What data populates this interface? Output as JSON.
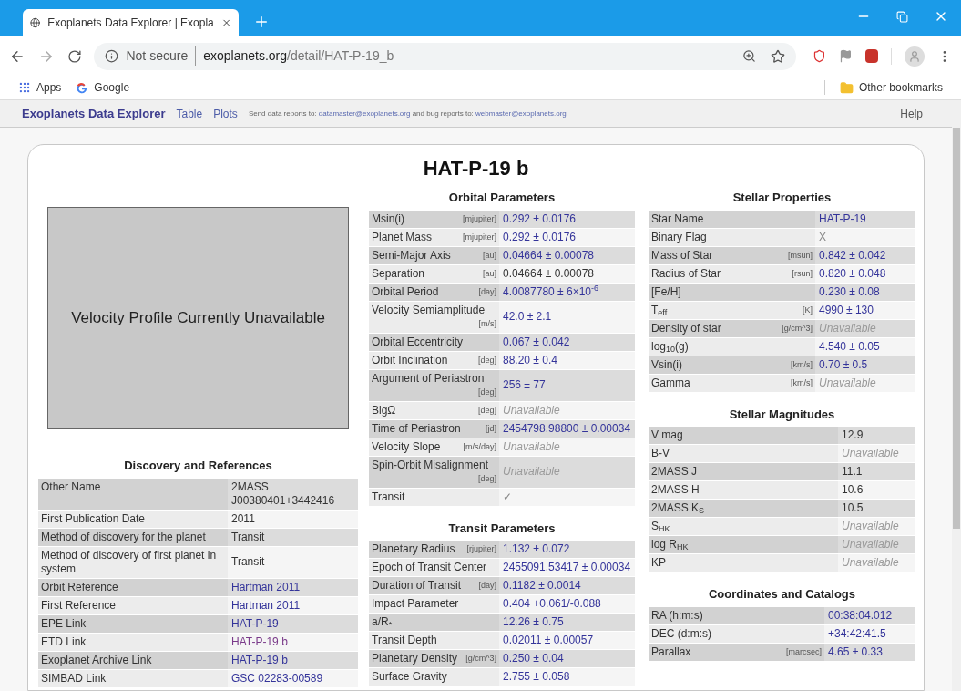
{
  "browser": {
    "tab": {
      "title": "Exoplanets Data Explorer | Exopla",
      "selected": true
    },
    "address": {
      "security": "Not secure",
      "host": "exoplanets.org",
      "path": "/detail/HAT-P-19_b"
    },
    "bookmarks": [
      {
        "kind": "apps",
        "label": "Apps"
      },
      {
        "kind": "google",
        "label": "Google"
      }
    ],
    "other_bookmarks": "Other bookmarks"
  },
  "site_nav": {
    "brand": "Exoplanets Data Explorer",
    "links": [
      "Table",
      "Plots"
    ],
    "notice": [
      {
        "kind": "text",
        "text": "Send data reports to: "
      },
      {
        "kind": "link",
        "text": "datamaster@exoplanets.org"
      },
      {
        "kind": "text",
        "text": " and bug reports to: "
      },
      {
        "kind": "link",
        "text": "webmaster@exoplanets.org"
      }
    ],
    "help": "Help"
  },
  "title": "HAT-P-19 b",
  "velocity_placeholder": "Velocity Profile Currently Unavailable",
  "columns": [
    [
      {
        "title": "Discovery and References",
        "rows": [
          {
            "label": "Other Name",
            "value": "2MASS J00380401+3442416",
            "kind": "plain"
          },
          {
            "label": "First Publication Date",
            "value": "2011",
            "kind": "plain"
          },
          {
            "label": "Method of discovery for the planet",
            "value": "Transit",
            "kind": "plain"
          },
          {
            "label": "Method of discovery of first planet in system",
            "value": "Transit",
            "kind": "plain"
          },
          {
            "label": "Orbit Reference",
            "value": "Hartman 2011",
            "kind": "link"
          },
          {
            "label": "First Reference",
            "value": "Hartman 2011",
            "kind": "link"
          },
          {
            "label": "EPE Link",
            "value": "HAT-P-19",
            "kind": "link"
          },
          {
            "label": "ETD Link",
            "value": "HAT-P-19 b",
            "kind": "visited"
          },
          {
            "label": "Exoplanet Archive Link",
            "value": "HAT-P-19 b",
            "kind": "link"
          },
          {
            "label": "SIMBAD Link",
            "value": "GSC 02283-00589",
            "kind": "link"
          }
        ]
      }
    ],
    [
      {
        "title": "Orbital Parameters",
        "rows": [
          {
            "label": "Msin(i)",
            "unit": "[mjupiter]",
            "value": "0.292 ± 0.0176",
            "kind": "value"
          },
          {
            "label": "Planet Mass",
            "unit": "[mjupiter]",
            "value": "0.292 ± 0.0176",
            "kind": "value"
          },
          {
            "label": "Semi-Major Axis",
            "unit": "[au]",
            "value": "0.04664 ± 0.00078",
            "kind": "value"
          },
          {
            "label": "Separation",
            "unit": "[au]",
            "value": "0.04664 ± 0.00078",
            "kind": "plain"
          },
          {
            "label": "Orbital Period",
            "unit": "[day]",
            "value": "4.0087780 ± 6×10$^{-6}$",
            "kind": "value"
          },
          {
            "label": "Velocity Semiamplitude",
            "unit": "[m/s]",
            "value": "42.0 ± 2.1",
            "kind": "value"
          },
          {
            "label": "Orbital Eccentricity",
            "value": "0.067 ± 0.042",
            "kind": "value"
          },
          {
            "label": "Orbit Inclination",
            "unit": "[deg]",
            "value": "88.20 ± 0.4",
            "kind": "value"
          },
          {
            "label": "Argument of Periastron",
            "unit": "[deg]",
            "value": "256 ± 77",
            "kind": "value"
          },
          {
            "label": "BigΩ",
            "unit": "[deg]",
            "value": "Unavailable",
            "kind": "unavailable"
          },
          {
            "label": "Time of Periastron",
            "unit": "[jd]",
            "value": "2454798.98800 ± 0.00034",
            "kind": "value"
          },
          {
            "label": "Velocity Slope",
            "unit": "[m/s/day]",
            "value": "Unavailable",
            "kind": "unavailable"
          },
          {
            "label": "Spin-Orbit Misalignment",
            "unit": "[deg]",
            "value": "Unavailable",
            "kind": "unavailable"
          },
          {
            "label": "Transit",
            "value": "✓",
            "kind": "check"
          }
        ]
      },
      {
        "title": "Transit Parameters",
        "rows": [
          {
            "label": "Planetary Radius",
            "unit": "[rjupiter]",
            "value": "1.132 ± 0.072",
            "kind": "value"
          },
          {
            "label": "Epoch of Transit Center",
            "value": "2455091.53417 ± 0.00034",
            "kind": "value"
          },
          {
            "label": "Duration of Transit",
            "unit": "[day]",
            "value": "0.1182 ± 0.0014",
            "kind": "value"
          },
          {
            "label": "Impact Parameter",
            "value": "0.404 +0.061/-0.088",
            "kind": "value"
          },
          {
            "label": "a/R$_{*}$",
            "value": "12.26 ± 0.75",
            "kind": "value"
          },
          {
            "label": "Transit Depth",
            "value": "0.02011 ± 0.00057",
            "kind": "value"
          },
          {
            "label": "Planetary Density",
            "unit": "[g/cm^3]",
            "value": "0.250 ± 0.04",
            "kind": "value"
          },
          {
            "label": "Surface Gravity",
            "value": "2.755 ± 0.058",
            "kind": "value"
          }
        ]
      }
    ],
    [
      {
        "title": "Stellar Properties",
        "rows": [
          {
            "label": "Star Name",
            "value": "HAT-P-19",
            "kind": "link"
          },
          {
            "label": "Binary Flag",
            "value": "X",
            "kind": "muted"
          },
          {
            "label": "Mass of Star",
            "unit": "[msun]",
            "value": "0.842 ± 0.042",
            "kind": "value"
          },
          {
            "label": "Radius of Star",
            "unit": "[rsun]",
            "value": "0.820 ± 0.048",
            "kind": "value"
          },
          {
            "label": "[Fe/H]",
            "value": "0.230 ± 0.08",
            "kind": "value"
          },
          {
            "label": "T$_{eff}$",
            "unit": "[K]",
            "value": "4990 ± 130",
            "kind": "value"
          },
          {
            "label": "Density of star",
            "unit": "[g/cm^3]",
            "value": "Unavailable",
            "kind": "unavailable"
          },
          {
            "label": "log$_{10}$(g)",
            "value": "4.540 ± 0.05",
            "kind": "value"
          },
          {
            "label": "Vsin(i)",
            "unit": "[km/s]",
            "value": "0.70 ± 0.5",
            "kind": "value"
          },
          {
            "label": "Gamma",
            "unit": "[km/s]",
            "value": "Unavailable",
            "kind": "unavailable"
          }
        ]
      },
      {
        "title": "Stellar Magnitudes",
        "rows": [
          {
            "label": "V mag",
            "value": "12.9",
            "kind": "plain"
          },
          {
            "label": "B-V",
            "value": "Unavailable",
            "kind": "unavailable"
          },
          {
            "label": "2MASS J",
            "value": "11.1",
            "kind": "plain"
          },
          {
            "label": "2MASS H",
            "value": "10.6",
            "kind": "plain"
          },
          {
            "label": "2MASS K$_{S}$",
            "value": "10.5",
            "kind": "plain"
          },
          {
            "label": "S$_{HK}$",
            "value": "Unavailable",
            "kind": "unavailable"
          },
          {
            "label": "log R$_{HK}$",
            "value": "Unavailable",
            "kind": "unavailable"
          },
          {
            "label": "KP",
            "value": "Unavailable",
            "kind": "unavailable"
          }
        ]
      },
      {
        "title": "Coordinates and Catalogs",
        "rows": [
          {
            "label": "RA (h:m:s)",
            "value": "00:38:04.012",
            "kind": "value"
          },
          {
            "label": "DEC (d:m:s)",
            "value": "+34:42:41.5",
            "kind": "value"
          },
          {
            "label": "Parallax",
            "unit": "[marcsec]",
            "value": "4.65 ± 0.33",
            "kind": "value"
          }
        ]
      }
    ]
  ]
}
